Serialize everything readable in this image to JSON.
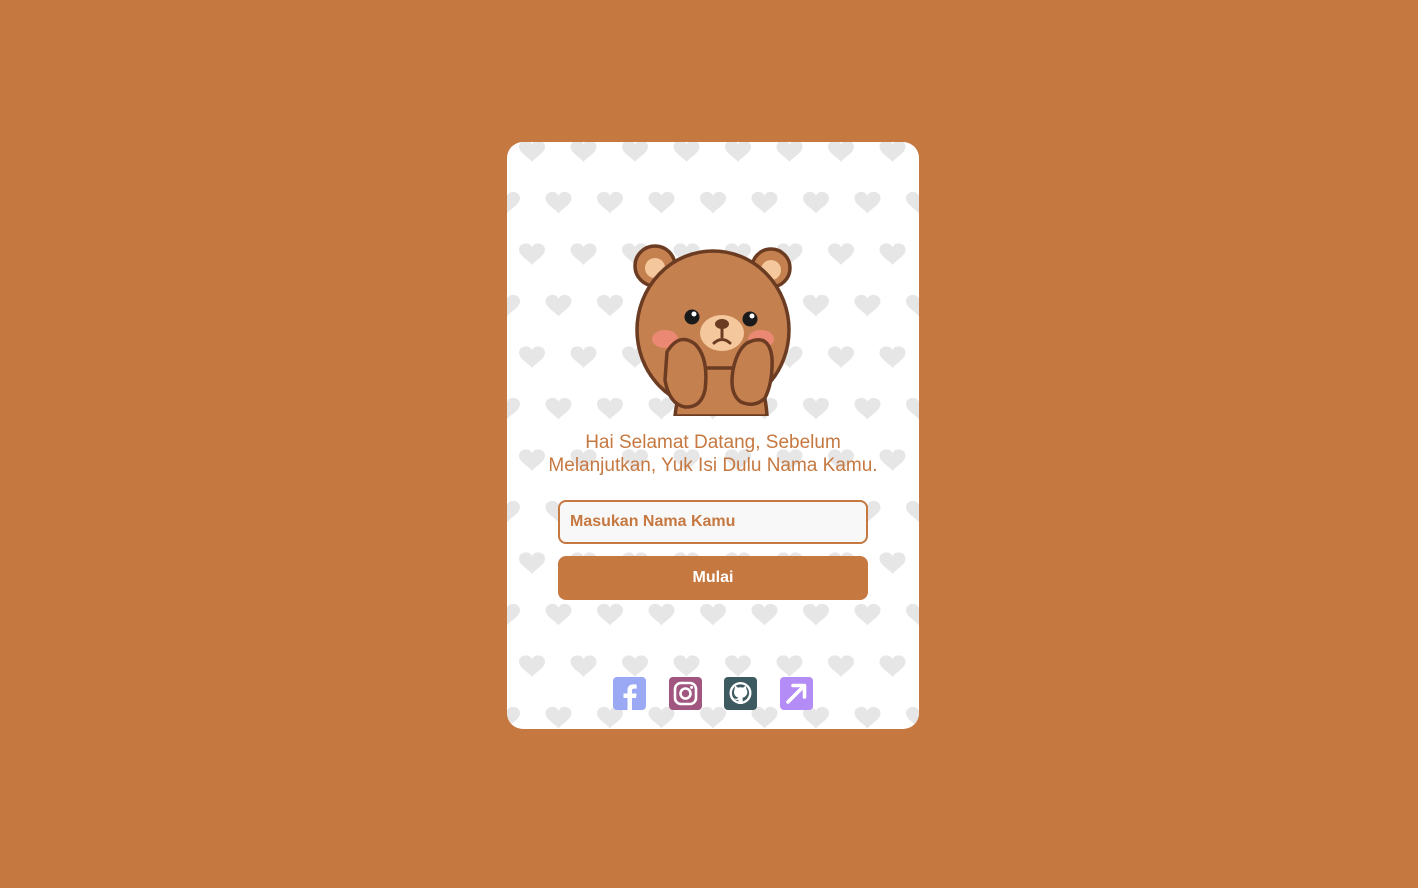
{
  "welcome": {
    "line1": "Hai Selamat Datang, Sebelum",
    "line2": "Melanjutkan, Yuk Isi Dulu Nama Kamu."
  },
  "form": {
    "name_placeholder": "Masukan Nama Kamu",
    "name_value": "",
    "start_label": "Mulai"
  },
  "socials": [
    {
      "name": "facebook",
      "icon": "facebook-icon",
      "color": "#9ba9f5"
    },
    {
      "name": "instagram",
      "icon": "instagram-icon",
      "color": "#a0567e"
    },
    {
      "name": "github",
      "icon": "github-icon",
      "color": "#3c5a5f"
    },
    {
      "name": "link",
      "icon": "external-link-icon",
      "color": "#b48cf5"
    }
  ],
  "colors": {
    "background": "#c67841",
    "card": "#ffffff",
    "accent": "#c67841",
    "heart_pattern": "#e6e6e6"
  }
}
